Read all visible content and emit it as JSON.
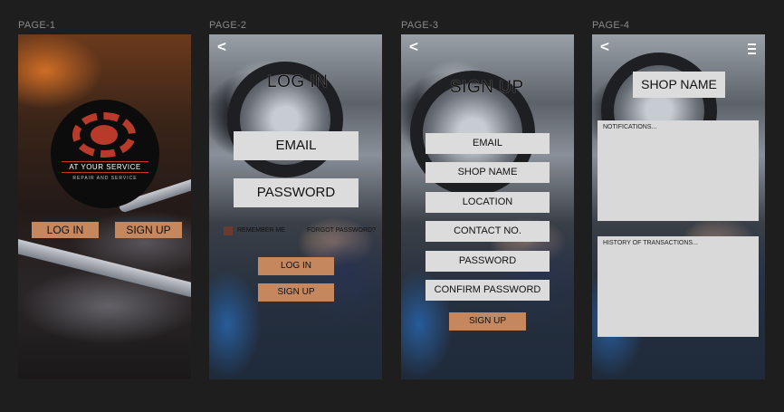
{
  "pages": [
    {
      "label": "PAGE-1",
      "logo": {
        "name": "AT YOUR SERVICE",
        "tagline": "REPAIR AND SERVICE"
      },
      "login_label": "LOG IN",
      "signup_label": "SIGN UP"
    },
    {
      "label": "PAGE-2",
      "back": "<",
      "title": "LOG IN",
      "email_label": "EMAIL",
      "password_label": "PASSWORD",
      "remember_label": "REMEMBER ME",
      "forgot_label": "FORGOT PASSWORD?",
      "login_label": "LOG IN",
      "signup_label": "SIGN UP"
    },
    {
      "label": "PAGE-3",
      "back": "<",
      "title": "SIGN UP",
      "fields": [
        "EMAIL",
        "SHOP NAME",
        "LOCATION",
        "CONTACT NO.",
        "PASSWORD",
        "CONFIRM PASSWORD"
      ],
      "signup_label": "SIGN UP"
    },
    {
      "label": "PAGE-4",
      "back": "<",
      "title": "SHOP NAME",
      "notifications_label": "NOTIFICATIONS...",
      "history_label": "HISTORY OF TRANSACTIONS..."
    }
  ],
  "colors": {
    "button": "#c4875e",
    "field": "#dcdcdc",
    "panel": "#d9d9d9",
    "canvas": "#1e1e1e"
  }
}
